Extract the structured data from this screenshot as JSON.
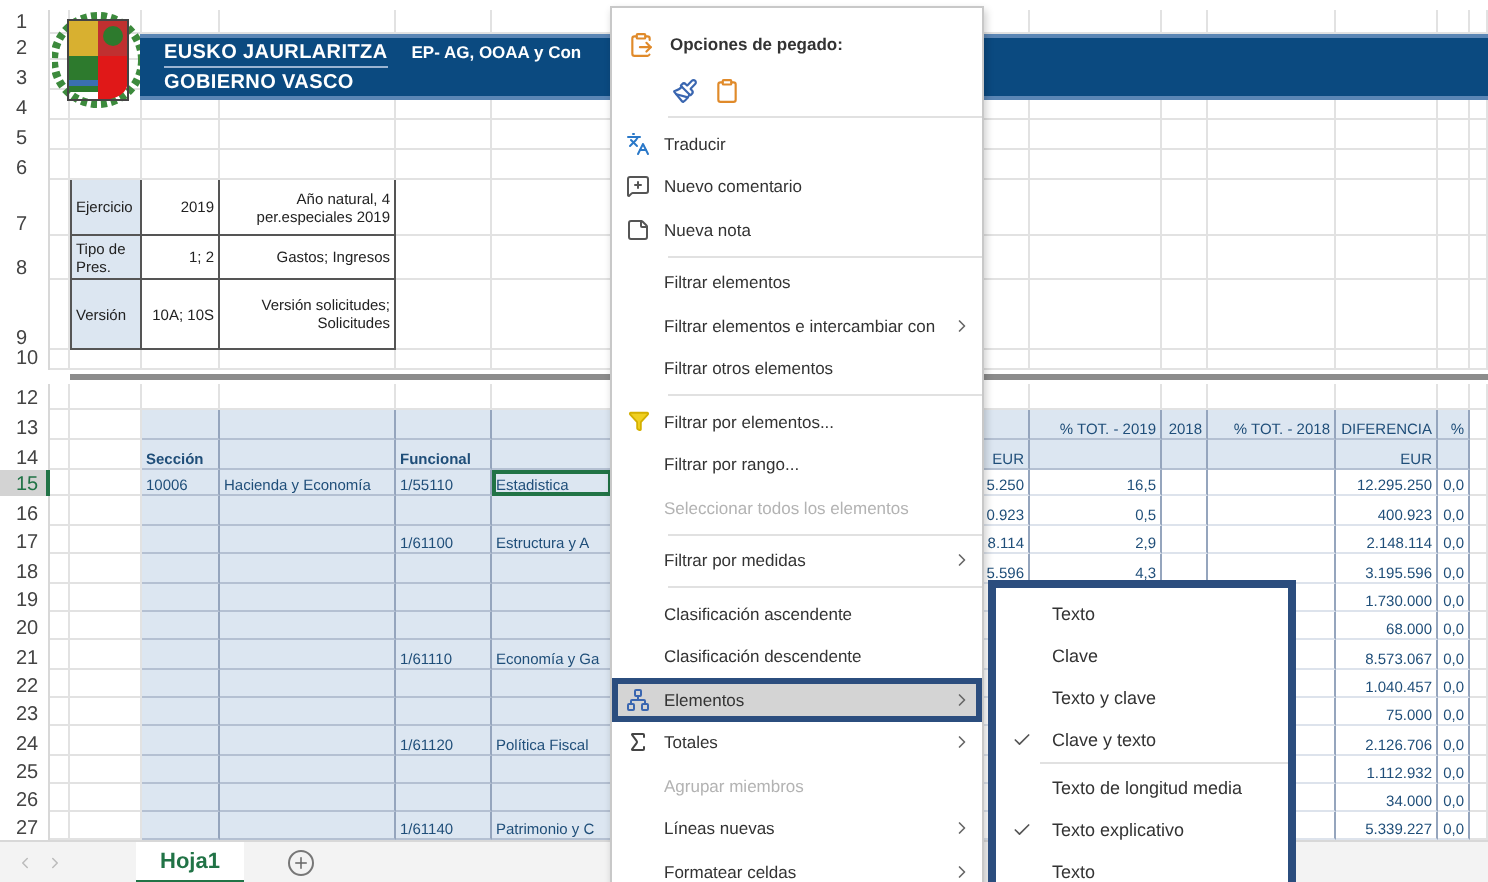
{
  "banner": {
    "line1": "EUSKO JAURLARITZA",
    "line2": "GOBIERNO VASCO",
    "report_title": "EP- AG, OOAA y Con"
  },
  "rows": [
    {
      "number": "1",
      "kind": "blank",
      "selected": false
    },
    {
      "number": "2",
      "kind": "blank",
      "selected": false
    },
    {
      "number": "3",
      "kind": "blank",
      "selected": false
    },
    {
      "number": "4",
      "kind": "blank",
      "selected": false
    },
    {
      "number": "5",
      "kind": "blank",
      "selected": false
    },
    {
      "number": "6",
      "kind": "blank",
      "selected": false
    },
    {
      "number": "7",
      "kind": "info",
      "selected": false,
      "cells": {
        "column_2": "Ejercicio",
        "column_3": "2019",
        "column_4": "Año natural, 4 per.especiales 2019"
      }
    },
    {
      "number": "8",
      "kind": "info",
      "selected": false,
      "cells": {
        "column_2": "Tipo de Pres.",
        "column_3": "1; 2",
        "column_4": "Gastos; Ingresos"
      }
    },
    {
      "number": "9",
      "kind": "info",
      "selected": false,
      "cells": {
        "column_2": "Versión",
        "column_3": "10A; 10S",
        "column_4": "Versión solicitudes; Solicitudes"
      }
    },
    {
      "number": "10",
      "kind": "blank",
      "selected": false
    },
    {
      "kind": "divider"
    },
    {
      "number": "12",
      "kind": "blank",
      "selected": false
    },
    {
      "number": "13",
      "kind": "head",
      "selected": false,
      "cells": {
        "column_9": "% TOT. - 2019",
        "column_10": "2018",
        "column_11": "% TOT. - 2018",
        "column_12": "DIFERENCIA",
        "column_13": "%"
      }
    },
    {
      "number": "14",
      "kind": "head",
      "selected": false,
      "cells": {
        "column_3": "Sección",
        "column_5": "Funcional",
        "column_8": "EUR",
        "column_12": "EUR"
      }
    },
    {
      "number": "15",
      "kind": "data",
      "selected": true,
      "cells": {
        "column_3": "10006",
        "column_4": "Hacienda y Economía",
        "column_5": "1/55110",
        "column_6": {
          "text": "Estadistica",
          "active": true
        },
        "column_8": "5.250",
        "column_9": "16,5",
        "column_12": "12.295.250",
        "column_13": "0,0"
      }
    },
    {
      "number": "16",
      "kind": "data",
      "selected": false,
      "cells": {
        "column_8": "0.923",
        "column_9": "0,5",
        "column_12": "400.923",
        "column_13": "0,0"
      }
    },
    {
      "number": "17",
      "kind": "data",
      "selected": false,
      "cells": {
        "column_5": "1/61100",
        "column_6": "Estructura y A",
        "column_8": "8.114",
        "column_9": "2,9",
        "column_12": "2.148.114",
        "column_13": "0,0"
      }
    },
    {
      "number": "18",
      "kind": "data",
      "selected": false,
      "cells": {
        "column_8": "5.596",
        "column_9": "4,3",
        "column_12": "3.195.596",
        "column_13": "0,0"
      }
    },
    {
      "number": "19",
      "kind": "data",
      "selected": false,
      "cells": {
        "column_12": "1.730.000",
        "column_13": "0,0"
      }
    },
    {
      "number": "20",
      "kind": "data",
      "selected": false,
      "cells": {
        "column_12": "68.000",
        "column_13": "0,0"
      }
    },
    {
      "number": "21",
      "kind": "data",
      "selected": false,
      "cells": {
        "column_5": "1/61110",
        "column_6": "Economía y Ga",
        "column_12": "8.573.067",
        "column_13": "0,0"
      }
    },
    {
      "number": "22",
      "kind": "data",
      "selected": false,
      "cells": {
        "column_12": "1.040.457",
        "column_13": "0,0"
      }
    },
    {
      "number": "23",
      "kind": "data",
      "selected": false,
      "cells": {
        "column_12": "75.000",
        "column_13": "0,0"
      }
    },
    {
      "number": "24",
      "kind": "data",
      "selected": false,
      "cells": {
        "column_5": "1/61120",
        "column_6": "Política Fiscal",
        "column_12": "2.126.706",
        "column_13": "0,0"
      }
    },
    {
      "number": "25",
      "kind": "data",
      "selected": false,
      "cells": {
        "column_12": "1.112.932",
        "column_13": "0,0"
      }
    },
    {
      "number": "26",
      "kind": "data",
      "selected": false,
      "cells": {
        "column_12": "34.000",
        "column_13": "0,0"
      }
    },
    {
      "number": "27",
      "kind": "data",
      "selected": false,
      "cells": {
        "column_5": "1/61140",
        "column_6": "Patrimonio y C",
        "column_12": "5.339.227",
        "column_13": "0,0"
      }
    }
  ],
  "context_menu": [
    {
      "kind": "header",
      "label": "Opciones de pegado:"
    },
    {
      "kind": "paste_options"
    },
    {
      "kind": "separator"
    },
    {
      "kind": "item",
      "label": "Traducir",
      "disabled": false,
      "submenu": false,
      "selected": false
    },
    {
      "kind": "item",
      "label": "Nuevo comentario",
      "disabled": false,
      "submenu": false,
      "selected": false
    },
    {
      "kind": "item",
      "label": "Nueva nota",
      "disabled": false,
      "submenu": false,
      "selected": false
    },
    {
      "kind": "separator"
    },
    {
      "kind": "item",
      "label": "Filtrar elementos",
      "disabled": false,
      "submenu": false,
      "selected": false
    },
    {
      "kind": "item",
      "label": "Filtrar elementos e intercambiar con",
      "disabled": false,
      "submenu": true,
      "selected": false
    },
    {
      "kind": "item",
      "label": "Filtrar otros elementos",
      "disabled": false,
      "submenu": false,
      "selected": false
    },
    {
      "kind": "separator"
    },
    {
      "kind": "item",
      "label": "Filtrar por elementos...",
      "disabled": false,
      "submenu": false,
      "selected": false
    },
    {
      "kind": "item",
      "label": "Filtrar por rango...",
      "disabled": false,
      "submenu": false,
      "selected": false
    },
    {
      "kind": "item",
      "label": "Seleccionar todos los elementos",
      "disabled": true,
      "submenu": false,
      "selected": false
    },
    {
      "kind": "separator"
    },
    {
      "kind": "item",
      "label": "Filtrar por medidas",
      "disabled": false,
      "submenu": true,
      "selected": false
    },
    {
      "kind": "separator"
    },
    {
      "kind": "item",
      "label": "Clasificación ascendente",
      "disabled": false,
      "submenu": false,
      "selected": false
    },
    {
      "kind": "item",
      "label": "Clasificación descendente",
      "disabled": false,
      "submenu": false,
      "selected": false
    },
    {
      "kind": "item",
      "label": "Elementos",
      "disabled": false,
      "submenu": true,
      "selected": true
    },
    {
      "kind": "item",
      "label": "Totales",
      "disabled": false,
      "submenu": true,
      "selected": false
    },
    {
      "kind": "item",
      "label": "Agrupar miembros",
      "disabled": true,
      "submenu": false,
      "selected": false
    },
    {
      "kind": "item",
      "label": "Líneas nuevas",
      "disabled": false,
      "submenu": true,
      "selected": false
    },
    {
      "kind": "item",
      "label": "Formatear celdas",
      "disabled": false,
      "submenu": true,
      "selected": false
    }
  ],
  "submenu": [
    {
      "kind": "item",
      "label": "Texto",
      "checked": false
    },
    {
      "kind": "item",
      "label": "Clave",
      "checked": false
    },
    {
      "kind": "item",
      "label": "Texto y clave",
      "checked": false
    },
    {
      "kind": "item",
      "label": "Clave y texto",
      "checked": true
    },
    {
      "kind": "separator"
    },
    {
      "kind": "item",
      "label": "Texto de longitud media",
      "checked": false
    },
    {
      "kind": "item",
      "label": "Texto explicativo",
      "checked": true
    },
    {
      "kind": "item",
      "label": "Texto",
      "checked": false
    }
  ],
  "sheet_tabs": [
    {
      "label": "Hoja1",
      "selected": true
    }
  ]
}
